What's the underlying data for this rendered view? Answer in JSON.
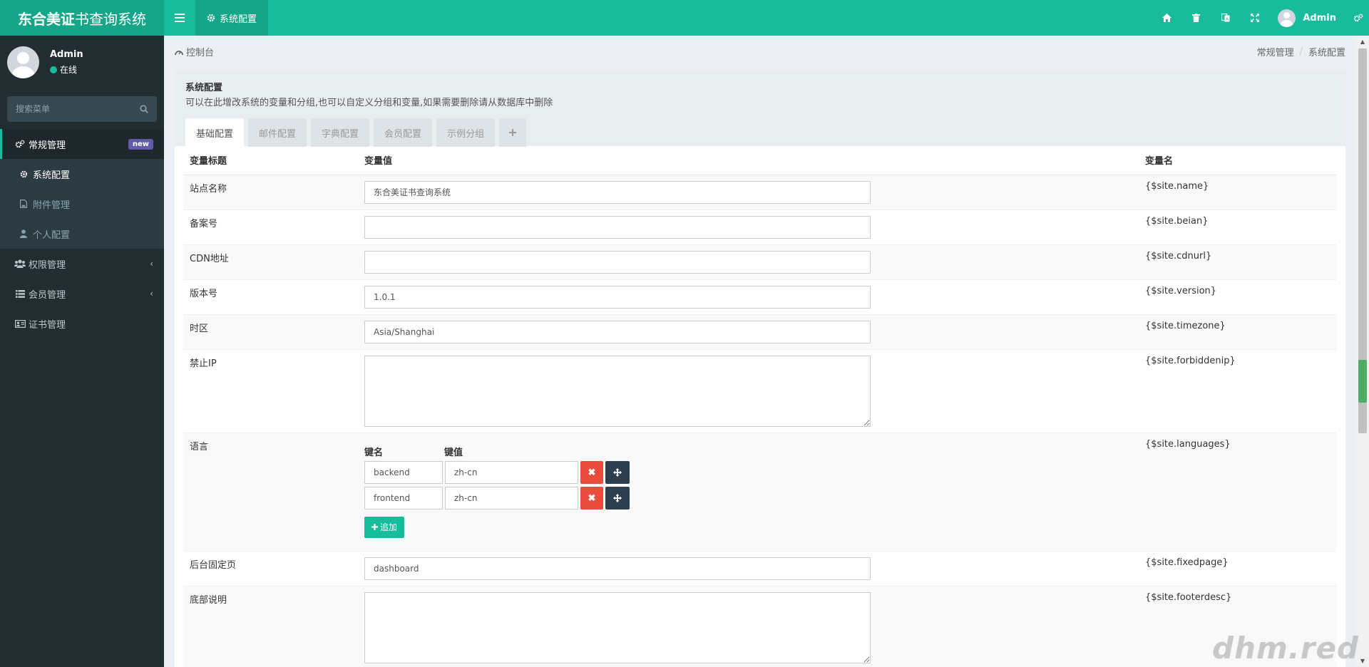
{
  "header": {
    "logo_bold": "东合美证",
    "logo_light": "书查询系统",
    "active_tab": "系统配置",
    "user_name": "Admin"
  },
  "sidebar": {
    "user_name": "Admin",
    "status": "在线",
    "search_placeholder": "搜索菜单",
    "menu": [
      {
        "label": "常规管理",
        "icon": "cogs-icon",
        "badge": "new"
      },
      {
        "label": "权限管理",
        "icon": "group-icon"
      },
      {
        "label": "会员管理",
        "icon": "list-icon"
      },
      {
        "label": "证书管理",
        "icon": "id-card-icon"
      }
    ],
    "submenu": [
      {
        "label": "系统配置",
        "icon": "cog-icon"
      },
      {
        "label": "附件管理",
        "icon": "file-image-icon"
      },
      {
        "label": "个人配置",
        "icon": "user-icon"
      }
    ]
  },
  "breadcrumb": {
    "home": "控制台",
    "items": [
      "常规管理",
      "系统配置"
    ]
  },
  "panel": {
    "title": "系统配置",
    "desc": "可以在此增改系统的变量和分组,也可以自定义分组和变量,如果需要删除请从数据库中删除",
    "tabs": [
      "基础配置",
      "邮件配置",
      "字典配置",
      "会员配置",
      "示例分组"
    ]
  },
  "table": {
    "headers": [
      "变量标题",
      "变量值",
      "变量名"
    ],
    "rows": [
      {
        "title": "站点名称",
        "value": "东合美证书查询系统",
        "name": "{$site.name}"
      },
      {
        "title": "备案号",
        "value": "",
        "name": "{$site.beian}"
      },
      {
        "title": "CDN地址",
        "value": "",
        "name": "{$site.cdnurl}"
      },
      {
        "title": "版本号",
        "value": "1.0.1",
        "name": "{$site.version}"
      },
      {
        "title": "时区",
        "value": "Asia/Shanghai",
        "name": "{$site.timezone}"
      },
      {
        "title": "禁止IP",
        "value": "",
        "name": "{$site.forbiddenip}"
      },
      {
        "title": "语言",
        "name": "{$site.languages}"
      },
      {
        "title": "后台固定页",
        "value": "dashboard",
        "name": "{$site.fixedpage}"
      },
      {
        "title": "底部说明",
        "value": "",
        "name": "{$site.footerdesc}"
      }
    ],
    "languages": {
      "key_header": "键名",
      "value_header": "键值",
      "pairs": [
        {
          "key": "backend",
          "value": "zh-cn"
        },
        {
          "key": "frontend",
          "value": "zh-cn"
        }
      ],
      "add_label": "追加"
    }
  },
  "watermark": "dhm.red"
}
